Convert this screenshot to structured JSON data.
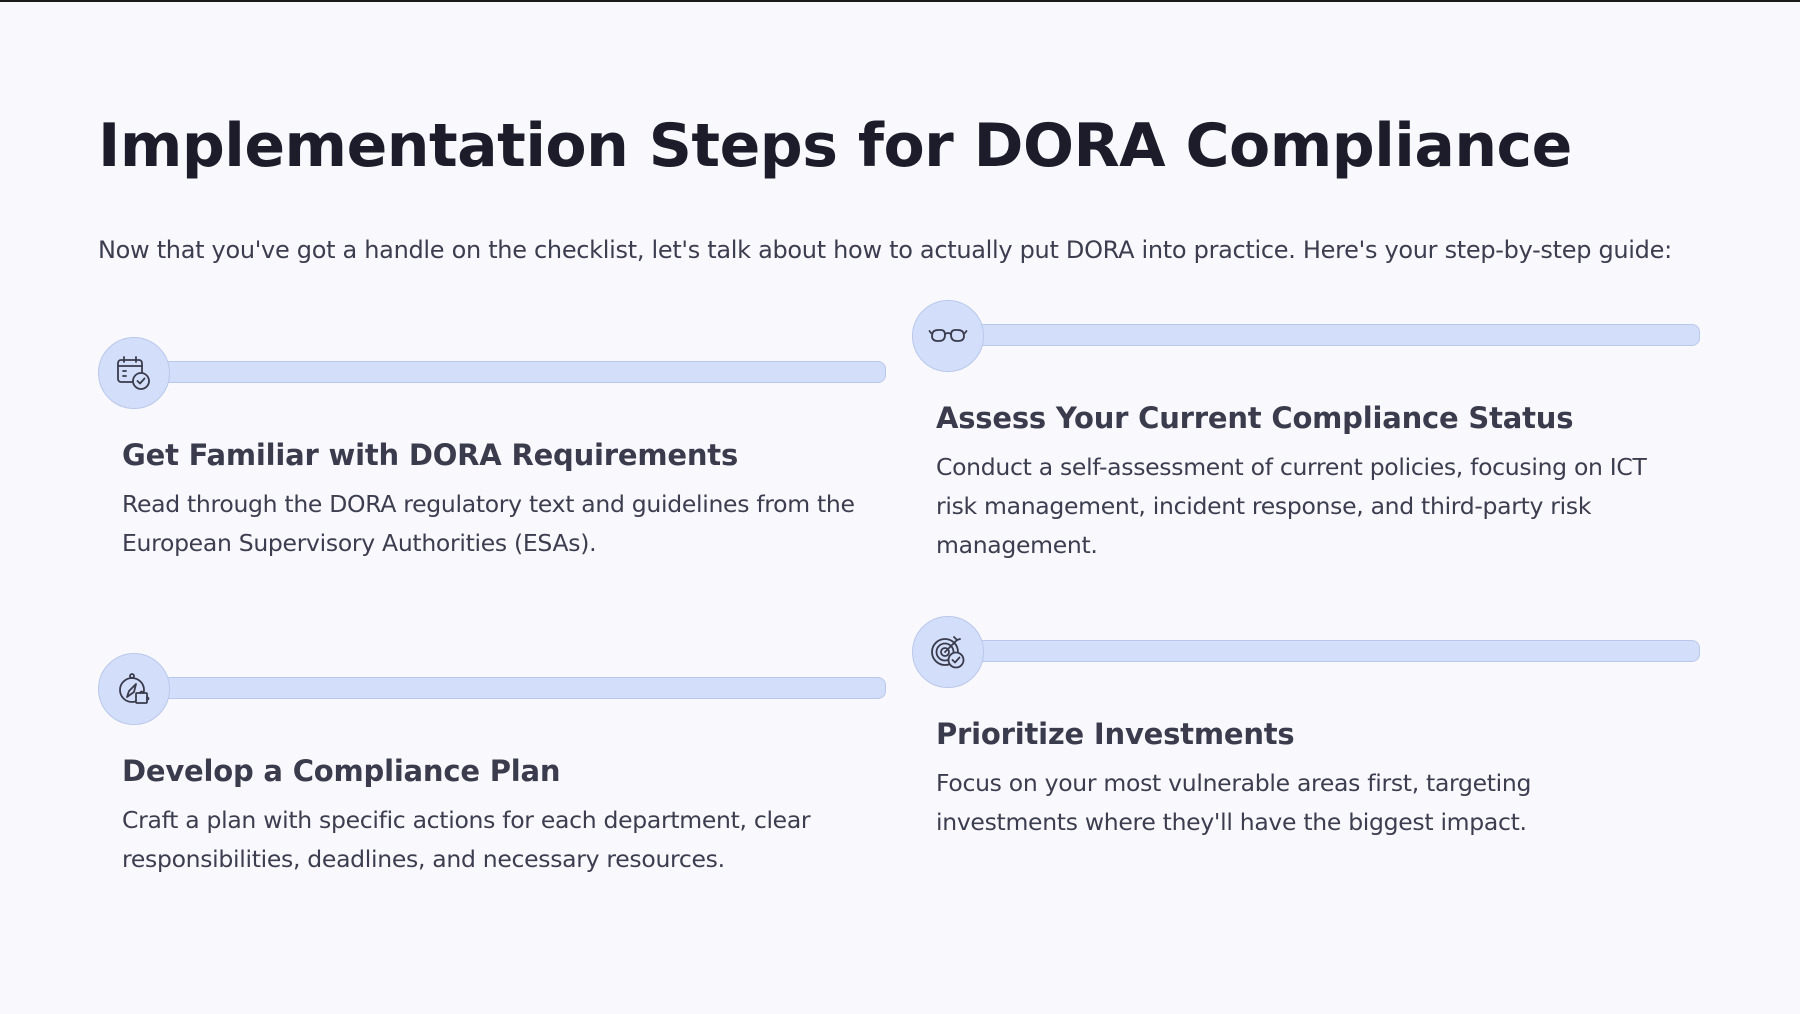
{
  "page": {
    "title": "Implementation Steps for DORA Compliance",
    "intro": "Now that you've got a handle on the checklist, let's talk about how to actually put DORA into practice. Here's your step-by-step guide:"
  },
  "steps": [
    {
      "icon": "calendar-check-icon",
      "title": "Get Familiar with DORA Requirements",
      "description": "Read through the DORA regulatory text and guidelines from the European Supervisory Authorities (ESAs)."
    },
    {
      "icon": "glasses-icon",
      "title": "Assess Your Current Compliance Status",
      "description": "Conduct a self-assessment of current policies, focusing on ICT risk management, incident response, and third-party risk management."
    },
    {
      "icon": "compass-puzzle-icon",
      "title": "Develop a Compliance Plan",
      "description": "Craft a plan with specific actions for each department, clear responsibilities, deadlines, and necessary resources."
    },
    {
      "icon": "target-check-icon",
      "title": "Prioritize Investments",
      "description": "Focus on your most vulnerable areas first, targeting investments where they'll have the biggest impact."
    }
  ],
  "colors": {
    "background": "#f8f8fd",
    "accent_fill": "#d3defa",
    "accent_border": "#b9c8ea",
    "title_text": "#1c1c2a",
    "body_text": "#3c3d4f"
  }
}
